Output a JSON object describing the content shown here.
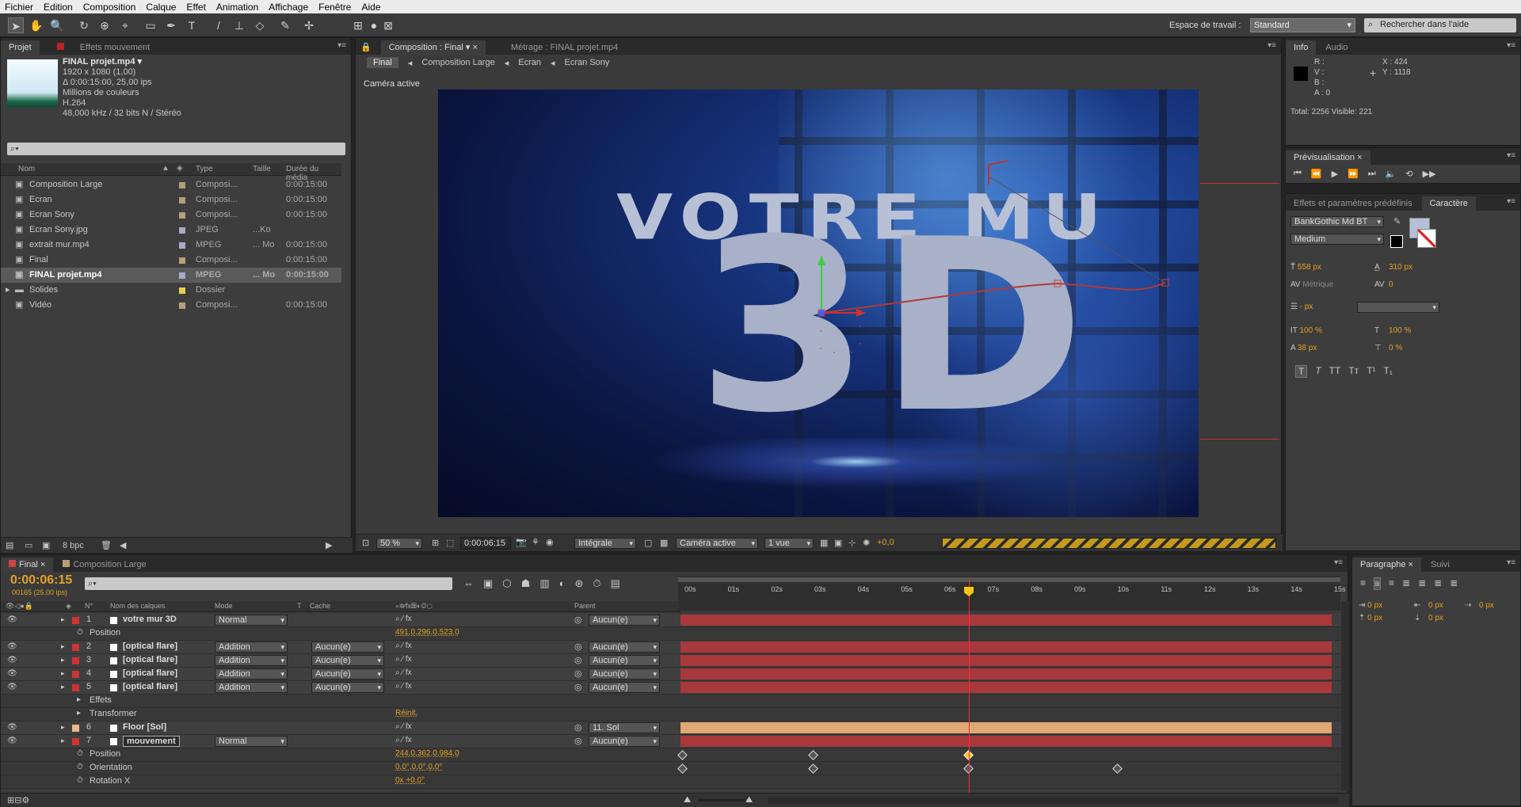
{
  "menu": [
    "Fichier",
    "Edition",
    "Composition",
    "Calque",
    "Effet",
    "Animation",
    "Affichage",
    "Fenêtre",
    "Aide"
  ],
  "toolbar": {
    "workspace_label": "Espace de travail :",
    "workspace": "Standard",
    "search": "Rechercher dans l'aide"
  },
  "project": {
    "tabs": [
      "Projet",
      "Effets mouvement"
    ],
    "footage": {
      "name": "FINAL projet.mp4 ▾",
      "res": "1920 x 1080 (1,00)",
      "dur": "Δ 0:00:15:00, 25,00 ips",
      "colors": "Millions de couleurs",
      "codec": "H.264",
      "audio": "48,000 kHz / 32 bits N / Stéréo"
    },
    "search_placeholder": "",
    "columns": [
      "Nom",
      "Type",
      "Taille",
      "Durée du média"
    ],
    "items": [
      {
        "name": "Composition Large",
        "type": "Composi...",
        "size": "",
        "dur": "0:00:15:00",
        "color": "#b5a07a",
        "icon": "composition-icon"
      },
      {
        "name": "Ecran",
        "type": "Composi...",
        "size": "",
        "dur": "0:00:15:00",
        "color": "#b5a07a",
        "icon": "composition-icon"
      },
      {
        "name": "Ecran Sony",
        "type": "Composi...",
        "size": "",
        "dur": "0:00:15:00",
        "color": "#b5a07a",
        "icon": "composition-icon"
      },
      {
        "name": "Ecran Sony.jpg",
        "type": "JPEG",
        "size": "...Ko",
        "dur": "",
        "color": "#a9a9c9",
        "icon": "image-icon"
      },
      {
        "name": "extrait mur.mp4",
        "type": "MPEG",
        "size": "... Mo",
        "dur": "0:00:15:00",
        "color": "#a9a9c9",
        "icon": "video-icon"
      },
      {
        "name": "Final",
        "type": "Composi...",
        "size": "",
        "dur": "0:00:15:00",
        "color": "#b5a07a",
        "icon": "composition-icon"
      },
      {
        "name": "FINAL projet.mp4",
        "type": "MPEG",
        "size": "... Mo",
        "dur": "0:00:15:00",
        "color": "#a9a9c9",
        "icon": "video-icon"
      },
      {
        "name": "Solides",
        "type": "Dossier",
        "size": "",
        "dur": "",
        "color": "#e6d24a",
        "icon": "folder-icon"
      },
      {
        "name": "Vidéo",
        "type": "Composi...",
        "size": "",
        "dur": "0:00:15:00",
        "color": "#b5a07a",
        "icon": "composition-icon"
      }
    ],
    "bpc": "8 bpc"
  },
  "comp": {
    "tab": "Composition : Final",
    "tab2": "Métrage : FINAL projet.mp4",
    "crumbs": [
      "Final",
      "Composition Large",
      "Ecran",
      "Ecran Sony"
    ],
    "camera": "Caméra active",
    "zoom": "50 %",
    "time": "0:00:06:15",
    "quality": "Intégrale",
    "view_cam": "Caméra active",
    "views": "1 vue",
    "exposure": "+0,0",
    "text_top": "VOTRE MU",
    "text_big": "3D"
  },
  "info": {
    "tabs": [
      "Info",
      "Audio"
    ],
    "r": "R :",
    "v": "V :",
    "b": "B :",
    "a": "A : 0",
    "x": "X : 424",
    "y": "Y : 1118",
    "total": "Total: 2256  Visible: 221"
  },
  "preview": {
    "tab": "Prévisualisation"
  },
  "character": {
    "tabs": [
      "Effets et paramètres prédéfinis",
      "Caractère"
    ],
    "font": "BankGothic Md BT",
    "style": "Medium",
    "size": "558 px",
    "leading": "310 px",
    "kern": "Métrique",
    "track": "0",
    "stroke": "- px",
    "vscale": "100 %",
    "hscale": "100 %",
    "baseline": "38 px",
    "tsume": "0 %"
  },
  "paragraph": {
    "tabs": [
      "Paragraphe",
      "Suivi"
    ],
    "v1": "0 px",
    "v2": "0 px",
    "v3": "0 px",
    "v4": "0 px",
    "v5": "0 px"
  },
  "timeline": {
    "tabs": [
      "Final",
      "Composition Large"
    ],
    "time": "0:00:06:15",
    "frames": "00165 (25.00 ips)",
    "headers": [
      "N°",
      "Nom des calques",
      "Mode",
      "T",
      "Cache",
      "Parent"
    ],
    "ruler": [
      "00s",
      "01s",
      "02s",
      "03s",
      "04s",
      "05s",
      "06s",
      "07s",
      "08s",
      "09s",
      "10s",
      "11s",
      "12s",
      "13s",
      "14s",
      "15s"
    ],
    "rows": [
      {
        "num": "1",
        "name": "votre mur 3D",
        "mode": "Normal",
        "cache": "",
        "parent": "Aucun(e)",
        "kind": "layer",
        "color": "#c33"
      },
      {
        "name": "Position",
        "value": "491,0,296,0,523,0",
        "kind": "prop"
      },
      {
        "num": "2",
        "name": "[optical flare]",
        "mode": "Addition",
        "cache": "Aucun(e)",
        "parent": "Aucun(e)",
        "kind": "layer",
        "color": "#c33"
      },
      {
        "num": "3",
        "name": "[optical flare]",
        "mode": "Addition",
        "cache": "Aucun(e)",
        "parent": "Aucun(e)",
        "kind": "layer",
        "color": "#c33"
      },
      {
        "num": "4",
        "name": "[optical flare]",
        "mode": "Addition",
        "cache": "Aucun(e)",
        "parent": "Aucun(e)",
        "kind": "layer",
        "color": "#c33"
      },
      {
        "num": "5",
        "name": "[optical flare]",
        "mode": "Addition",
        "cache": "Aucun(e)",
        "parent": "Aucun(e)",
        "kind": "layer",
        "color": "#c33"
      },
      {
        "name": "Effets",
        "value": "",
        "kind": "group"
      },
      {
        "name": "Transformer",
        "value": "Réinit.",
        "kind": "group"
      },
      {
        "num": "6",
        "name": "Floor [Sol]",
        "mode": "",
        "cache": "",
        "parent": "11. Sol",
        "kind": "layer",
        "color": "#e8b98a"
      },
      {
        "num": "7",
        "name": "mouvement",
        "mode": "Normal",
        "cache": "",
        "parent": "Aucun(e)",
        "kind": "layer",
        "color": "#c33"
      },
      {
        "name": "Position",
        "value": "244,0,362,0,984,0",
        "kind": "prop"
      },
      {
        "name": "Orientation",
        "value": "0,0°,0,0°,0,0°",
        "kind": "prop"
      },
      {
        "name": "Rotation X",
        "value": "0x +0,0°",
        "kind": "prop"
      }
    ]
  }
}
